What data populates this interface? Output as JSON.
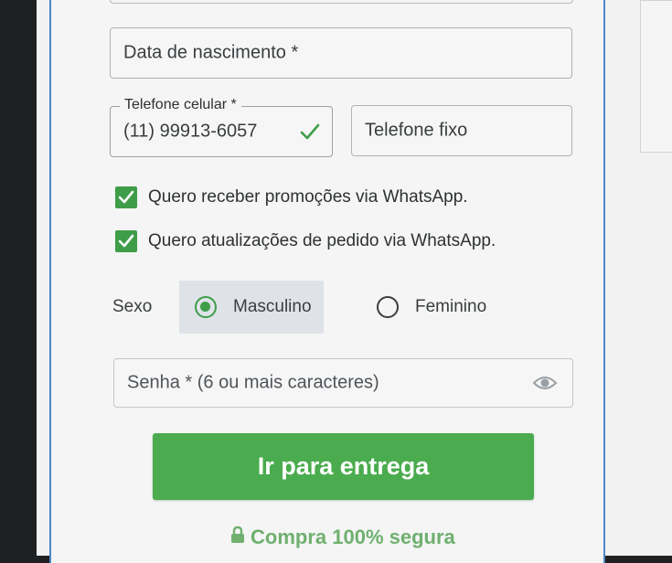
{
  "form": {
    "birthdate": {
      "placeholder": "Data de nascimento *"
    },
    "cellphone": {
      "label": "Telefone celular *",
      "value": "(11) 99913-6057",
      "status_icon": "check-icon"
    },
    "landline": {
      "placeholder": "Telefone fixo"
    },
    "whatsapp_promos": {
      "label": "Quero receber promoções via WhatsApp.",
      "checked": true
    },
    "whatsapp_orders": {
      "label": "Quero atualizações de pedido via WhatsApp.",
      "checked": true
    },
    "sex": {
      "label": "Sexo",
      "options": [
        {
          "label": "Masculino",
          "selected": true
        },
        {
          "label": "Feminino",
          "selected": false
        }
      ]
    },
    "password": {
      "placeholder": "Senha * (6 ou mais caracteres)",
      "toggle_icon": "eye-icon"
    },
    "submit_label": "Ir para entrega",
    "secure_text": "Compra 100% segura",
    "secure_icon": "lock-icon"
  },
  "colors": {
    "accent_green": "#4aac4e",
    "checkbox_green": "#3f9d49",
    "card_border_blue": "#4c86c9",
    "secure_text_green": "#6fb06f"
  }
}
